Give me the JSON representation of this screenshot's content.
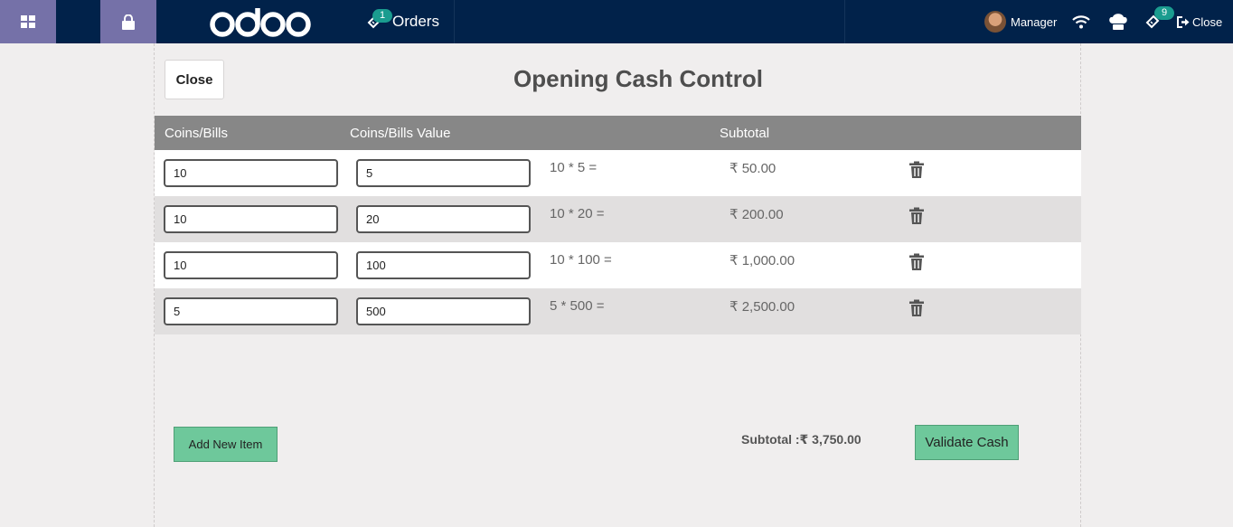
{
  "topbar": {
    "orders_label": "Orders",
    "orders_count": "1",
    "user_name": "Manager",
    "tickets_count": "9",
    "close_label": "Close",
    "bg_color": "#01224a",
    "accent_color": "#7571a8"
  },
  "dialog": {
    "close_label": "Close",
    "title": "Opening Cash Control",
    "columns": [
      "Coins/Bills",
      "Coins/Bills Value",
      "Subtotal"
    ],
    "rows": [
      {
        "count": "10",
        "value": "5",
        "formula": "10 * 5 =",
        "subtotal": "₹ 50.00"
      },
      {
        "count": "10",
        "value": "20",
        "formula": "10 * 20 =",
        "subtotal": "₹ 200.00"
      },
      {
        "count": "10",
        "value": "100",
        "formula": "10 * 100 =",
        "subtotal": "₹ 1,000.00"
      },
      {
        "count": "5",
        "value": "500",
        "formula": "5 * 500 =",
        "subtotal": "₹ 2,500.00"
      }
    ],
    "add_label": "Add New Item",
    "total_label": "Subtotal :₹ 3,750.00",
    "validate_label": "Validate Cash",
    "button_color": "#6ec89b"
  }
}
